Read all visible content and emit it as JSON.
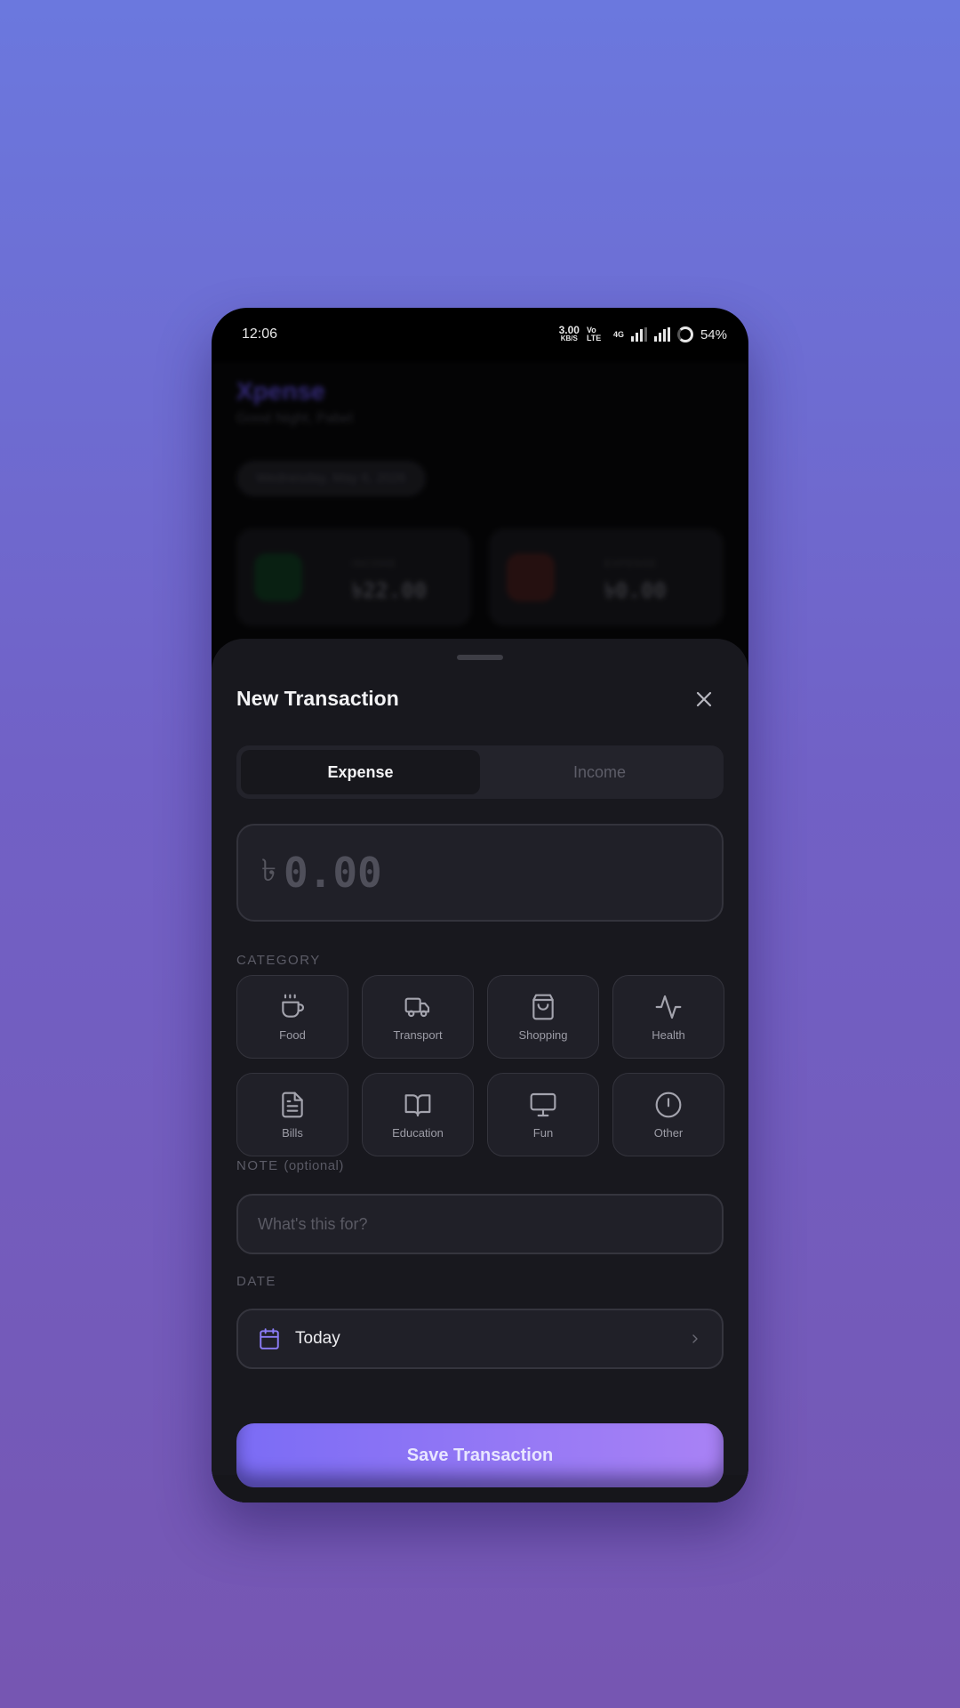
{
  "status_bar": {
    "time": "12:06",
    "speed": "3.00",
    "speed_unit": "KB/S",
    "volte": "Vo LTE",
    "network": "4G",
    "battery": "54%"
  },
  "background_app": {
    "title": "Xpense",
    "greeting": "Good Night, Pabel",
    "date": "Wednesday, May 6, 2026",
    "income_label": "INCOME",
    "income_value": "৳22.00",
    "expense_label": "EXPENSE",
    "expense_value": "৳0.00"
  },
  "sheet": {
    "title": "New Transaction",
    "tabs": [
      {
        "label": "Expense",
        "active": true
      },
      {
        "label": "Income",
        "active": false
      }
    ],
    "amount": {
      "currency": "৳",
      "placeholder": "0.00"
    },
    "category_label": "CATEGORY",
    "categories": [
      {
        "label": "Food",
        "icon": "coffee-cup-icon"
      },
      {
        "label": "Transport",
        "icon": "truck-icon"
      },
      {
        "label": "Shopping",
        "icon": "shopping-bag-icon"
      },
      {
        "label": "Health",
        "icon": "activity-icon"
      },
      {
        "label": "Bills",
        "icon": "document-icon"
      },
      {
        "label": "Education",
        "icon": "book-icon"
      },
      {
        "label": "Fun",
        "icon": "monitor-icon"
      },
      {
        "label": "Other",
        "icon": "alert-circle-icon"
      }
    ],
    "note_label": "NOTE",
    "note_optional": "(optional)",
    "note_placeholder": "What's this for?",
    "date_label": "DATE",
    "date_value": "Today",
    "save_label": "Save Transaction"
  },
  "colors": {
    "accent": "#7b6cf5",
    "accent_end": "#a982f5",
    "sheet_bg": "#18181e"
  }
}
